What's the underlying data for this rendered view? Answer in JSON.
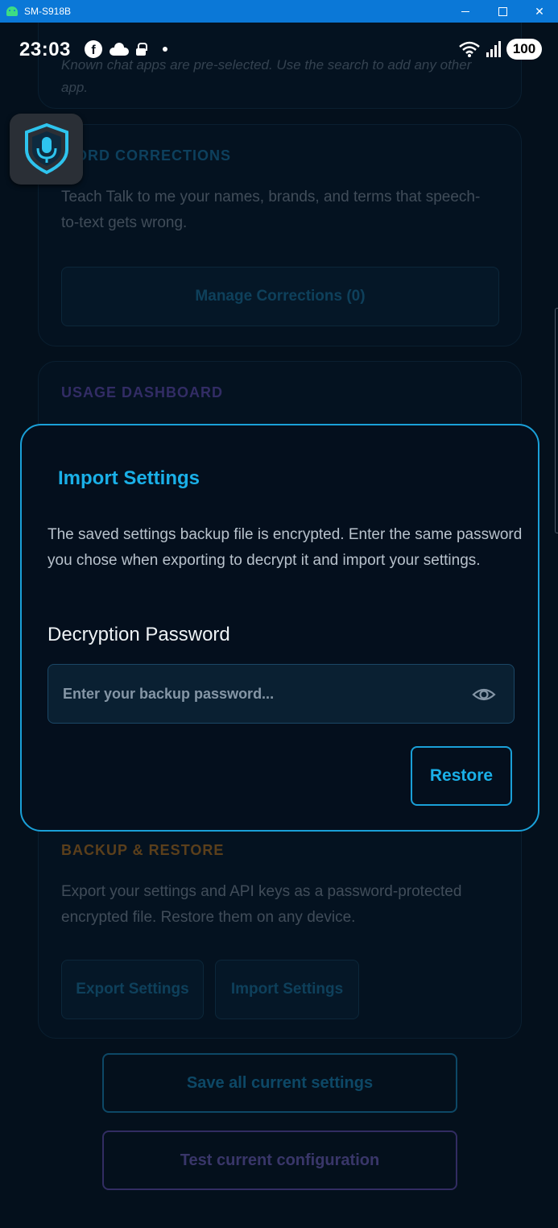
{
  "window": {
    "title": "SM-S918B",
    "controls": [
      "minimize",
      "maximize",
      "close"
    ]
  },
  "statusbar": {
    "time": "23:03",
    "battery": "100",
    "icons": [
      "facebook-icon",
      "cloud-icon",
      "lock-icon",
      "dot-icon",
      "wifi-icon",
      "signal-icon"
    ]
  },
  "background": {
    "chat_apps_hint": "Known chat apps are pre-selected. Use the search to add any other app.",
    "corrections": {
      "title": "WORD CORRECTIONS",
      "desc": "Teach Talk to me your names, brands, and terms that speech-to-text gets wrong.",
      "button": "Manage Corrections (0)"
    },
    "usage": {
      "title": "USAGE DASHBOARD"
    },
    "backup": {
      "title": "BACKUP & RESTORE",
      "desc": "Export your settings and API keys as a password-protected encrypted file. Restore them on any device.",
      "export_button": "Export Settings",
      "import_button": "Import Settings"
    },
    "save_button": "Save all current settings",
    "test_button": "Test current configuration"
  },
  "dialog": {
    "title": "Import Settings",
    "message": "The saved settings backup file is encrypted. Enter the same password you chose when exporting to decrypt it and import your settings.",
    "field_label": "Decryption Password",
    "field_value": "",
    "field_placeholder": "Enter your backup password...",
    "restore_button": "Restore"
  },
  "colors": {
    "accent": "#1aa0d8",
    "usage_title": "#6b4fbf",
    "backup_title": "#c4781a",
    "test_border": "#6a50b8",
    "background": "#04101c"
  }
}
